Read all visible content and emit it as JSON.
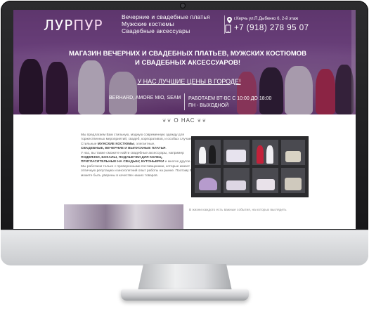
{
  "header": {
    "logo_part1": "ЛУР",
    "logo_part2": "ПУР",
    "tagline": [
      "Вечерние и свадебные платья",
      "Мужские костюмы",
      "Свадебные аксессуары"
    ],
    "address": "г.Керчь ул.П.Дыбенко 6, 2-й этаж",
    "phone": "+7 (918) 278 95 07"
  },
  "hero": {
    "title": "МАГАЗИН ВЕЧЕРНИХ И СВАДЕБНЫХ ПЛАТЬЕВ, МУЖСКИХ КОСТЮМОВ И СВАДЕБНЫХ АКСЕССУАРОВ!",
    "promo": "У НАС ЛУЧШИЕ ЦЕНЫ В ГОРОДЕ!",
    "brands": "BERHARD, AMORE MIO, SEAM",
    "hours_line1": "РАБОТАЕМ ВТ-ВС С 10:00 ДО 18:00",
    "hours_line2": "ПН - ВЫХОДНОЙ"
  },
  "about": {
    "heading": "О НАС",
    "p1_a": "Мы предлагаем Вам стильную, модную современную одежду для торжественных мероприятий, свадеб, корпоративов, и особых случаев. Стильные ",
    "p1_b": "МУЖСКИЕ КОСТЮМЫ",
    "p1_c": ", элегантные,",
    "p1_d": "СВАДЕБНЫЕ, ВЕЧЕРНИЕ И ВЫПУСКНЫЕ ПЛАТЬЯ",
    "p1_e": ".",
    "p2_a": "У нас, вы также сможете найти свадебные аксессуары, например ",
    "p2_b": "ПОДВЯЗКИ, БОКАЛЫ, ПОДУШЕЧКИ ДЛЯ КОЛЕЦ, ПРИГЛАСИТЕЛЬНЫЕ НА СВАДЬБУ, БУТОНЬЕРКИ",
    "p2_c": " и многое другое.",
    "p3": "Мы работаем только с проверенными поставщиками, которые имеют отличную репутацию и многолетний опыт работы на рынке. Поэтому Вы можете быть уверены в качестве наших товаров.",
    "bottom_text": "В жизни каждого есть важные события, на которых выглядеть"
  },
  "colors": {
    "hero_purple": "#7b4f8e",
    "logo_accent": "#f5d6ef"
  },
  "icons": [
    "map-pin-icon",
    "phone-icon"
  ]
}
